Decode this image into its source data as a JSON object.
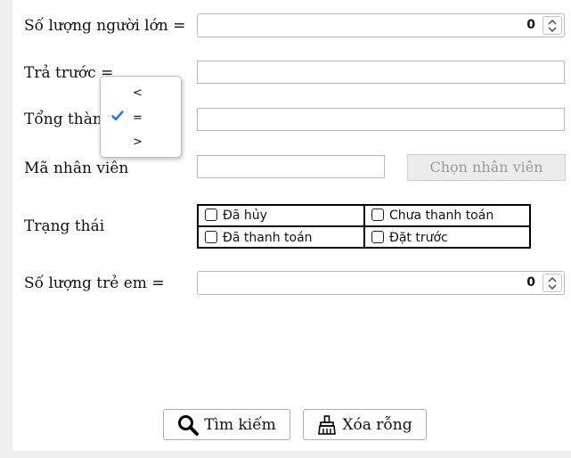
{
  "form": {
    "adults": {
      "label": "Số lượng người lớn =",
      "value": "0"
    },
    "prepaid": {
      "label": "Trả trước =",
      "value": ""
    },
    "total": {
      "label": "Tổng thành",
      "value": ""
    },
    "employee": {
      "label": "Mã nhân viên",
      "value": "",
      "choose_button": "Chọn nhân viên"
    },
    "status": {
      "label": "Trạng thái",
      "options": [
        "Đã hủy",
        "Chưa thanh toán",
        "Đã thanh toán",
        "Đặt trước"
      ]
    },
    "children": {
      "label": "Số lượng trẻ em =",
      "value": "0"
    }
  },
  "operator_popup": {
    "options": [
      "<",
      "=",
      ">"
    ],
    "selected": "=",
    "accent": "#1a73e8"
  },
  "actions": {
    "search_label": "Tìm kiếm",
    "clear_label": "Xóa rỗng",
    "search_icon": "magnifier-icon",
    "clear_icon": "broom-icon"
  }
}
